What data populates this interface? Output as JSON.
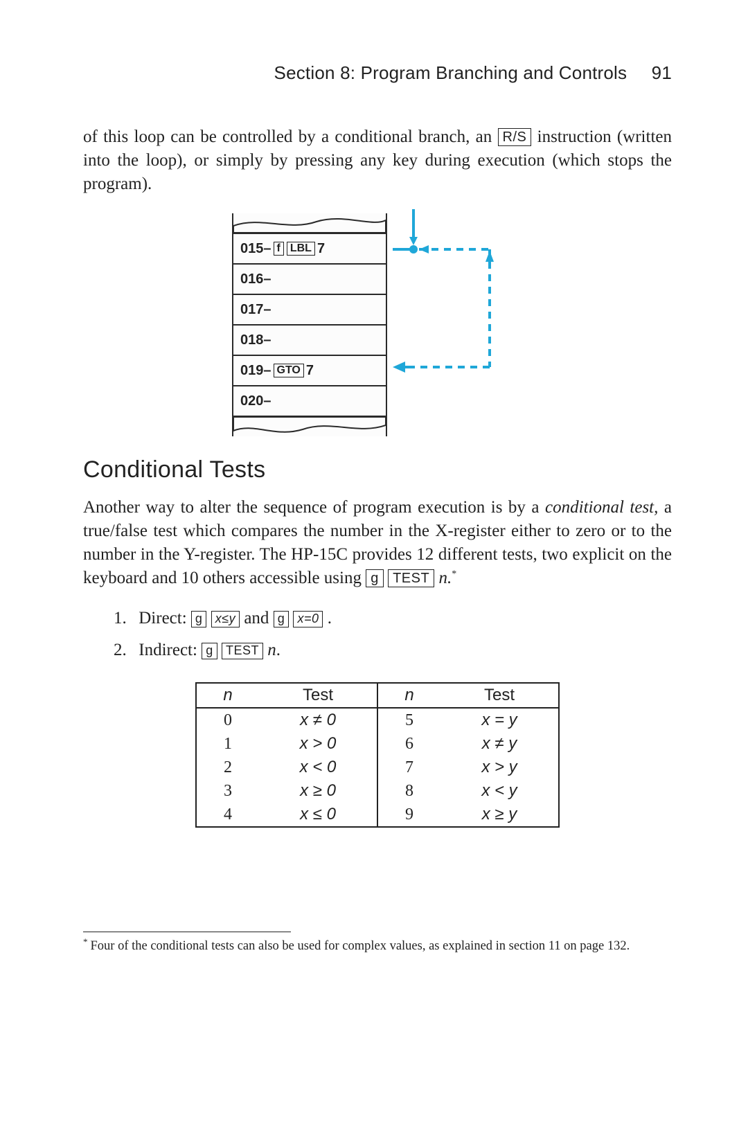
{
  "header": {
    "section": "Section 8: Program Branching and Controls",
    "page": "91"
  },
  "para1": {
    "pre": "of this loop can be controlled by a conditional branch, an ",
    "key_rs": "R/S",
    "post": " instruction (written into the loop), or simply by pressing any key during execution (which stops the program)."
  },
  "figure": {
    "rows": [
      {
        "num": "015–",
        "keys": [
          "f",
          "LBL"
        ],
        "suffix": "7"
      },
      {
        "num": "016–",
        "keys": [],
        "suffix": ""
      },
      {
        "num": "017–",
        "keys": [],
        "suffix": ""
      },
      {
        "num": "018–",
        "keys": [],
        "suffix": ""
      },
      {
        "num": "019–",
        "keys": [
          "GTO"
        ],
        "suffix": "7"
      },
      {
        "num": "020–",
        "keys": [],
        "suffix": ""
      }
    ]
  },
  "h2": "Conditional Tests",
  "para2": {
    "t1": "Another way to alter the sequence of program execution is by a ",
    "em": "conditional test,",
    "t2": " a true/false test which compares the number in the X-register either to zero or to the number in the Y-register. The HP-15C provides 12 different tests, two explicit on the keyboard and 10 others accessible using ",
    "key_g": "g",
    "key_test": "TEST",
    "trail": "n.",
    "sup": "*"
  },
  "list": {
    "item1": {
      "num": "1.",
      "label": "Direct: ",
      "k1": "g",
      "k2": "x≤y",
      "mid": " and ",
      "k3": "g",
      "k4": "x=0",
      "end": " ."
    },
    "item2": {
      "num": "2.",
      "label": "Indirect: ",
      "k1": "g",
      "k2": "TEST",
      "trail": "n",
      "end": "."
    }
  },
  "table": {
    "head_n": "n",
    "head_test": "Test",
    "rows": [
      {
        "n1": "0",
        "t1": "x ≠ 0",
        "n2": "5",
        "t2": "x = y"
      },
      {
        "n1": "1",
        "t1": "x > 0",
        "n2": "6",
        "t2": "x ≠ y"
      },
      {
        "n1": "2",
        "t1": "x < 0",
        "n2": "7",
        "t2": "x > y"
      },
      {
        "n1": "3",
        "t1": "x ≥ 0",
        "n2": "8",
        "t2": "x < y"
      },
      {
        "n1": "4",
        "t1": "x ≤ 0",
        "n2": "9",
        "t2": "x ≥ y"
      }
    ]
  },
  "footnote": {
    "mark": "*",
    "text": "Four of the conditional tests can also be used for complex values, as explained in section 11 on page 132."
  }
}
